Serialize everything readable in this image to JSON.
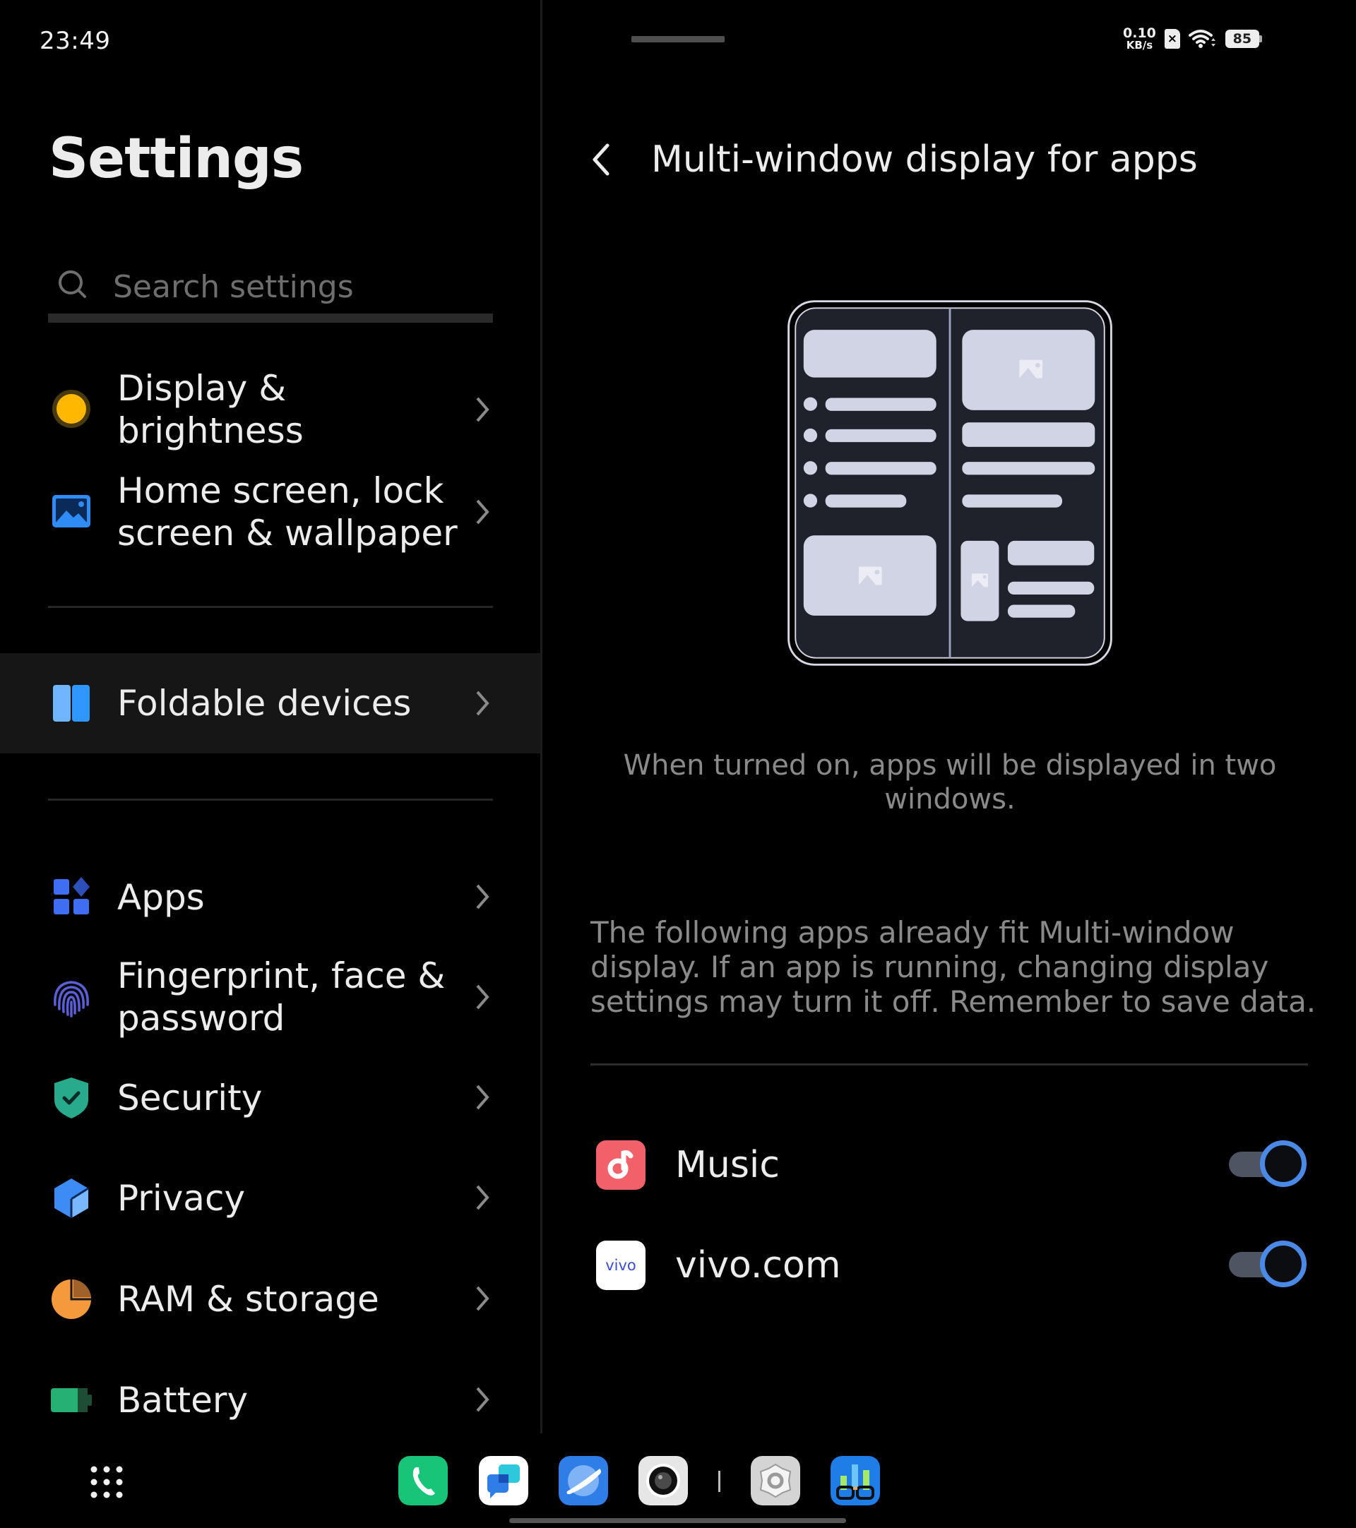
{
  "status_bar": {
    "time": "23:49",
    "net_speed_value": "0.10",
    "net_speed_unit": "KB/s",
    "sim_status": "×",
    "battery_level": "85"
  },
  "left_pane": {
    "title": "Settings",
    "search": {
      "placeholder": "Search settings",
      "value": ""
    },
    "menu_items": [
      {
        "label": "Display & brightness",
        "icon": "sun-icon",
        "color": "#ffb800"
      },
      {
        "label": "Home screen, lock screen & wallpaper",
        "icon": "wallpaper-icon",
        "color": "#2f8cf5"
      },
      {
        "label": "Foldable devices",
        "icon": "foldable-icon",
        "color": "#2f97ff",
        "selected": true
      },
      {
        "label": "Apps",
        "icon": "apps-icon",
        "color": "#3f6ef2"
      },
      {
        "label": "Fingerprint, face & password",
        "icon": "fingerprint-icon",
        "color": "#5a5fd6"
      },
      {
        "label": "Security",
        "icon": "shield-check-icon",
        "color": "#27ab8c"
      },
      {
        "label": "Privacy",
        "icon": "privacy-icon",
        "color": "#3d8bf5"
      },
      {
        "label": "RAM & storage",
        "icon": "pie-chart-icon",
        "color": "#f59a3c"
      },
      {
        "label": "Battery",
        "icon": "battery-icon",
        "color": "#27b074"
      }
    ]
  },
  "right_pane": {
    "title": "Multi-window display for apps",
    "description": "When turned on, apps will be displayed in two windows.",
    "note": "The following apps already fit Multi-window display. If an app is running, changing display settings may turn it off. Remember to save data.",
    "apps": [
      {
        "name": "Music",
        "icon": "music-app-icon",
        "enabled": true
      },
      {
        "name": "vivo.com",
        "icon": "vivo-app-icon",
        "icon_text": "vivo",
        "enabled": true
      }
    ]
  },
  "dock": {
    "apps": [
      {
        "name": "Phone",
        "icon": "phone-app-icon"
      },
      {
        "name": "Messages",
        "icon": "messages-app-icon"
      },
      {
        "name": "Browser",
        "icon": "browser-app-icon"
      },
      {
        "name": "Camera",
        "icon": "camera-app-icon"
      },
      {
        "name": "Settings",
        "icon": "settings-app-icon"
      },
      {
        "name": "Geekbench",
        "icon": "benchmark-app-icon"
      }
    ]
  },
  "colors": {
    "accent": "#4a8ae6",
    "toggle_track": "#4d5562",
    "selected_row_bg": "#161616"
  }
}
